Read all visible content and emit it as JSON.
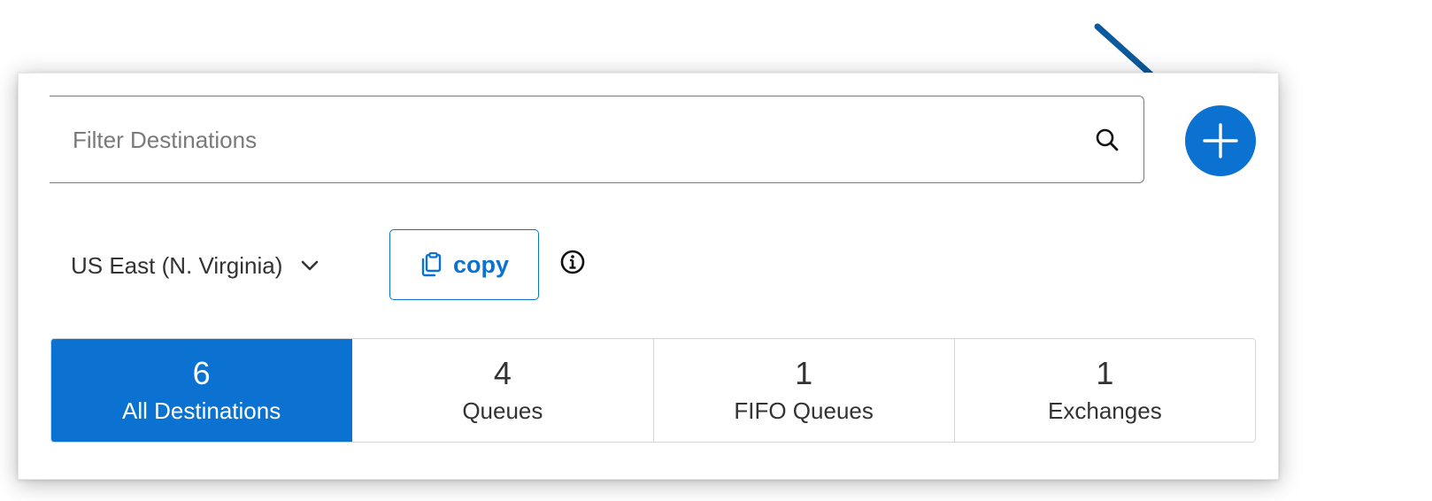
{
  "search": {
    "placeholder": "Filter Destinations",
    "value": ""
  },
  "add_button": {
    "icon": "plus-icon",
    "color": "#0b72d1"
  },
  "annotation": {
    "icon": "pointer-arrow",
    "color": "#0a5a9c"
  },
  "region": {
    "selected": "US East (N. Virginia)"
  },
  "copy_button": {
    "label": "copy",
    "icon": "clipboard-icon"
  },
  "info": {
    "icon": "info-icon"
  },
  "tabs": [
    {
      "count": "6",
      "label": "All Destinations",
      "active": true
    },
    {
      "count": "4",
      "label": "Queues",
      "active": false
    },
    {
      "count": "1",
      "label": "FIFO Queues",
      "active": false
    },
    {
      "count": "1",
      "label": "Exchanges",
      "active": false
    }
  ],
  "colors": {
    "accent": "#0b72d1",
    "text": "#333333",
    "border": "#d4d4d4"
  }
}
